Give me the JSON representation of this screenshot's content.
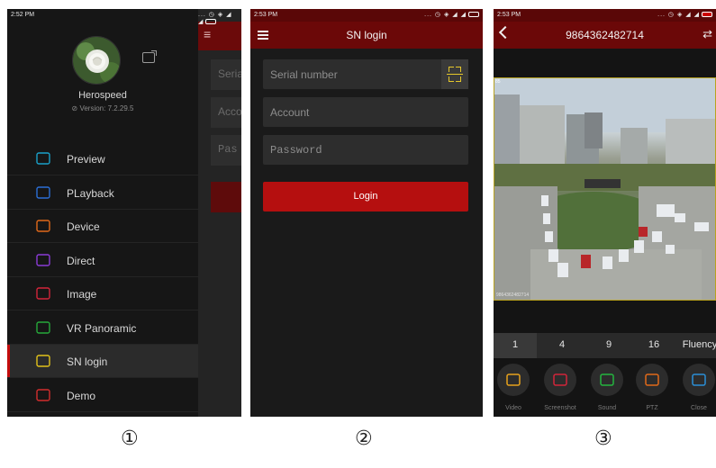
{
  "panel1": {
    "status": {
      "time": "2:52 PM",
      "icons": "... ◷ ◈ ◢ ◢"
    },
    "behind": {
      "fields": [
        "Serial",
        "Acco",
        "Pas"
      ]
    },
    "app_name": "Herospeed",
    "version": "Version: 7.2.29.5",
    "menu": [
      {
        "label": "Preview",
        "icon": "camera-icon",
        "color": "#1aa0c8"
      },
      {
        "label": "PLayback",
        "icon": "play-icon",
        "color": "#2b6fd6"
      },
      {
        "label": "Device",
        "icon": "gear-icon",
        "color": "#e0691a"
      },
      {
        "label": "Direct",
        "icon": "direct-icon",
        "color": "#8a3bd6"
      },
      {
        "label": "Image",
        "icon": "image-icon",
        "color": "#d2253a"
      },
      {
        "label": "VR Panoramic",
        "icon": "vr-360-icon",
        "color": "#26a83a"
      },
      {
        "label": "SN login",
        "icon": "barcode-icon",
        "color": "#e2c21b"
      },
      {
        "label": "Demo",
        "icon": "demo-icon",
        "color": "#d22d2d"
      }
    ],
    "active_index": 6
  },
  "panel2": {
    "status": {
      "time": "2:53 PM",
      "icons": "... ◷ ◈ ◢ ◢"
    },
    "title": "SN login",
    "serial_placeholder": "Serial number",
    "account_placeholder": "Account",
    "password_placeholder": "Password",
    "login_label": "Login",
    "accent": "#b50f0f"
  },
  "panel3": {
    "status": {
      "time": "2:53 PM",
      "icons": "... ◷ ◈ ◢ ◢"
    },
    "title": "9864362482714",
    "video_overlay": "9864362482714",
    "video_corner": "85",
    "split_options": [
      "1",
      "4",
      "9",
      "16",
      "Fluency"
    ],
    "controls": [
      {
        "label": "Video",
        "icon": "video-icon",
        "color": "#e6a21c"
      },
      {
        "label": "Screenshot",
        "icon": "screenshot-icon",
        "color": "#d2253a"
      },
      {
        "label": "Sound",
        "icon": "sound-icon",
        "color": "#25b53f"
      },
      {
        "label": "PTZ",
        "icon": "ptz-icon",
        "color": "#e0691a"
      },
      {
        "label": "Close",
        "icon": "close-icon",
        "color": "#2b8fd6"
      }
    ]
  },
  "labels": [
    "①",
    "②",
    "③"
  ]
}
